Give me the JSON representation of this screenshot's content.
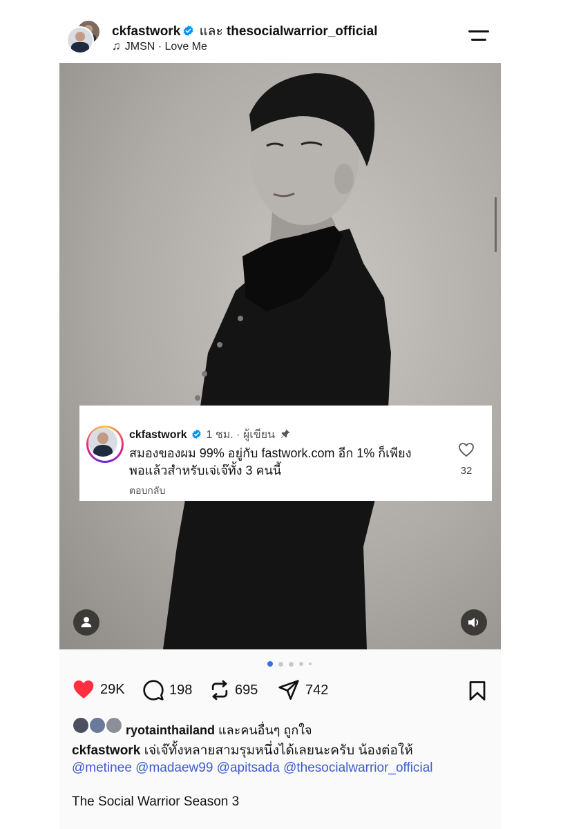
{
  "header": {
    "author": "ckfastwork",
    "conjunction": "และ",
    "coauthor": "thesocialwarrior_official",
    "music": "JMSN · Love Me"
  },
  "comment": {
    "author": "ckfastwork",
    "meta": "1 ชม. · ผู้เขียน",
    "text": "สมองของผม 99% อยู่กับ fastwork.com อีก 1% ก็เพียงพอแล้วสำหรับเจ่เจ๊ทั้ง 3 คนนี้",
    "reply_label": "ตอบกลับ",
    "like_count": "32"
  },
  "carousel": {
    "count": 5,
    "active_index": 0
  },
  "actions": {
    "likes": "29K",
    "comments": "198",
    "reposts": "695",
    "shares": "742"
  },
  "liked_by": {
    "user": "ryotainthailand",
    "suffix": "และคนอื่นๆ ถูกใจ"
  },
  "caption": {
    "user": "ckfastwork",
    "text": "เจ่เจ๊ทั้งหลายสามรุมหนึ่งได้เลยนะครับ น้องต่อให้",
    "mentions": "@metinee @madaew99 @apitsada @thesocialwarrior_official",
    "second_line": "The Social Warrior Season 3"
  },
  "colors": {
    "like_red": "#ff3040",
    "mention_blue": "#3b5bd1",
    "verified_blue": "#0095f6",
    "dot_active": "#3b6fe0"
  },
  "icons": [
    "music-note-icon",
    "verified-icon",
    "menu-icon",
    "pin-icon",
    "heart-icon",
    "comment-icon",
    "repost-icon",
    "share-icon",
    "bookmark-icon",
    "user-icon",
    "speaker-icon"
  ]
}
